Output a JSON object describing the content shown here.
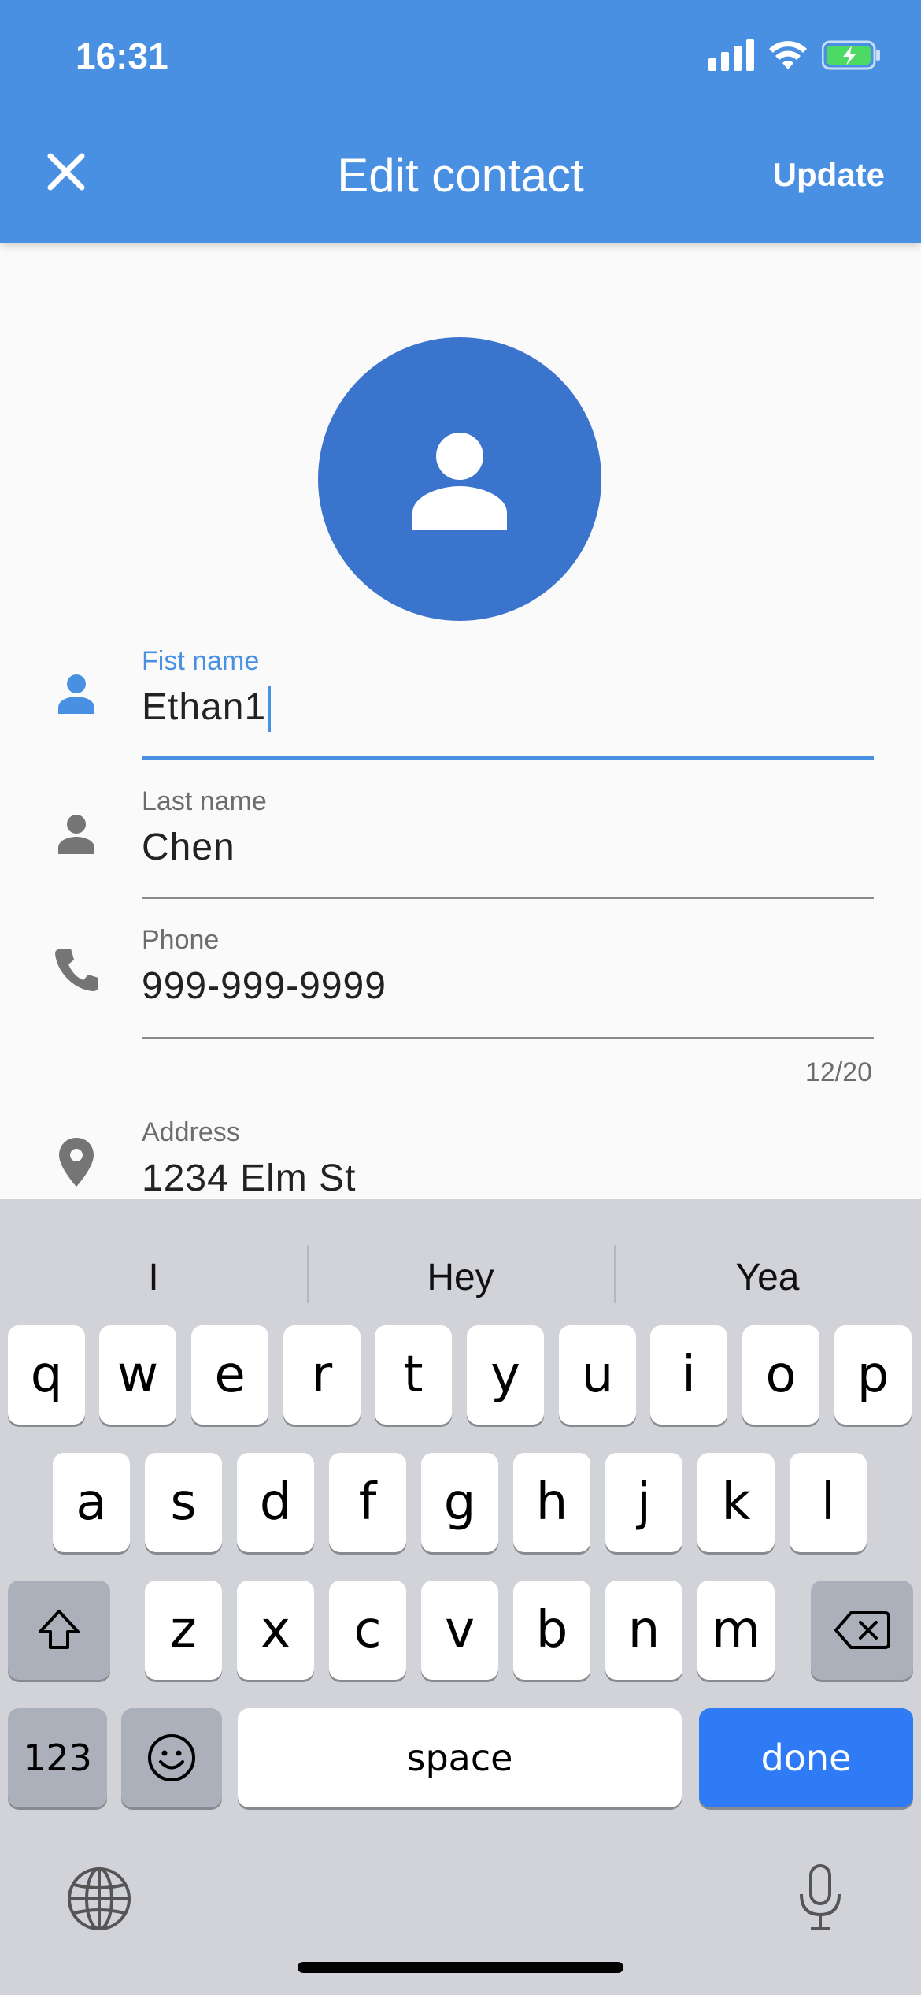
{
  "status_bar": {
    "time": "16:31"
  },
  "header": {
    "title": "Edit contact",
    "update_label": "Update"
  },
  "fields": {
    "first_name": {
      "label": "Fist name",
      "value": "Ethan1"
    },
    "last_name": {
      "label": "Last name",
      "value": "Chen"
    },
    "phone": {
      "label": "Phone",
      "value": "999-999-9999",
      "counter": "12/20"
    },
    "address": {
      "label": "Address",
      "value": "1234 Elm St"
    }
  },
  "keyboard": {
    "suggestions": [
      "I",
      "Hey",
      "Yea"
    ],
    "row1": [
      "q",
      "w",
      "e",
      "r",
      "t",
      "y",
      "u",
      "i",
      "o",
      "p"
    ],
    "row2": [
      "a",
      "s",
      "d",
      "f",
      "g",
      "h",
      "j",
      "k",
      "l"
    ],
    "row3": [
      "z",
      "x",
      "c",
      "v",
      "b",
      "n",
      "m"
    ],
    "numbers_label": "123",
    "space_label": "space",
    "done_label": "done"
  },
  "colors": {
    "primary": "#4a90e2",
    "avatar": "#3b74cc",
    "done_key": "#2f7bf5"
  }
}
